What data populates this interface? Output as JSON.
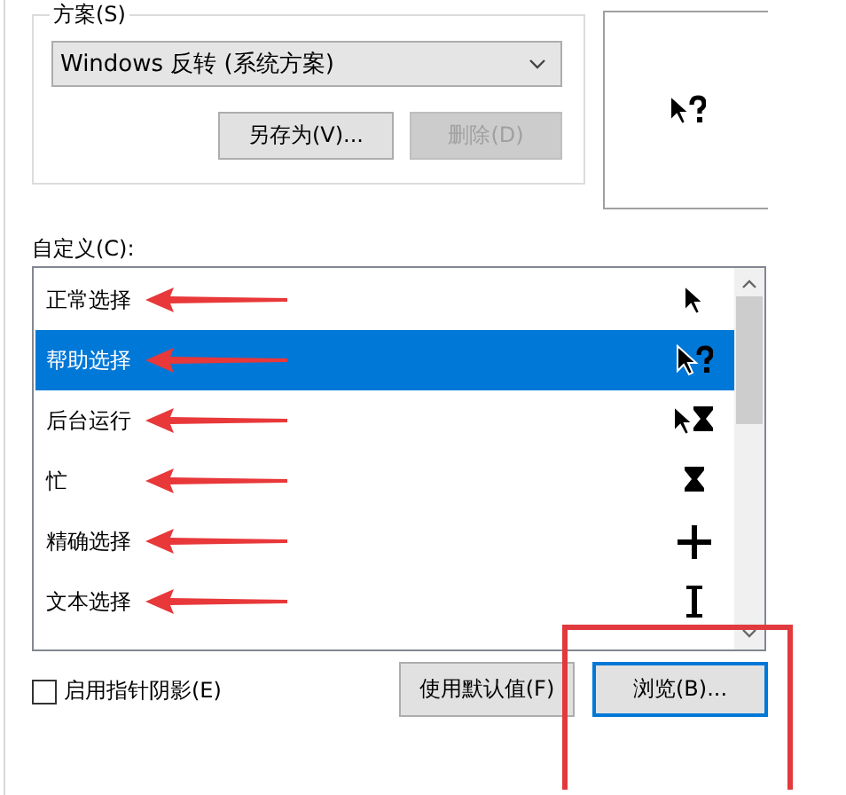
{
  "scheme": {
    "label": "方案(S)",
    "value": "Windows 反转 (系统方案)",
    "buttons": [
      {
        "label": "另存为(V)...",
        "disabled": false
      },
      {
        "label": "删除(D)",
        "disabled": true
      }
    ]
  },
  "preview": {
    "kind": "help"
  },
  "custom": {
    "label": "自定义(C):",
    "rows": [
      {
        "name": "正常选择",
        "kind": "arrow",
        "selected": false,
        "arrow": true
      },
      {
        "name": "帮助选择",
        "kind": "help",
        "selected": true,
        "arrow": true
      },
      {
        "name": "后台运行",
        "kind": "working",
        "selected": false,
        "arrow": true
      },
      {
        "name": "忙",
        "kind": "busy",
        "selected": false,
        "arrow": true
      },
      {
        "name": "精确选择",
        "kind": "cross",
        "selected": false,
        "arrow": true
      },
      {
        "name": "文本选择",
        "kind": "text",
        "selected": false,
        "arrow": true
      }
    ]
  },
  "shadow": {
    "label": "启用指针阴影(E)",
    "checked": false
  },
  "buttons": [
    {
      "label": "使用默认值(F)",
      "highlighted": false
    },
    {
      "label": "浏览(B)...",
      "highlighted": true
    }
  ]
}
